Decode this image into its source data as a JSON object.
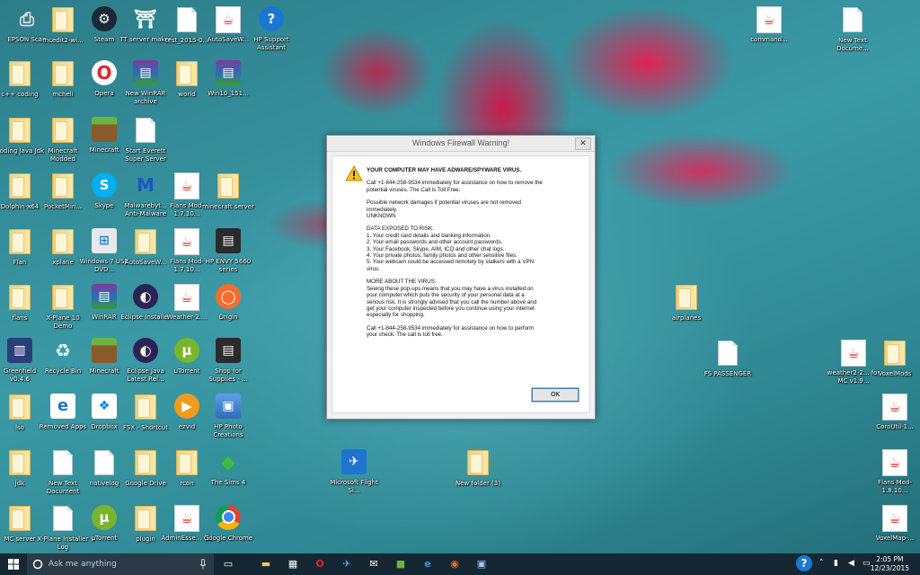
{
  "desktop_icons": [
    {
      "label": "EPSON Scan",
      "icon": "scanner-icon"
    },
    {
      "label": "mcedit2-wi...",
      "icon": "folder-icon"
    },
    {
      "label": "Steam",
      "icon": "steam-icon"
    },
    {
      "label": "TT server maker",
      "icon": "tt-icon"
    },
    {
      "label": "test_2015-0...",
      "icon": "document-icon"
    },
    {
      "label": "AutoSaveW...",
      "icon": "java-icon"
    },
    {
      "label": "HP Support Assistant",
      "icon": "help-icon"
    },
    {
      "label": "c++ coding",
      "icon": "folder-icon"
    },
    {
      "label": "mcheli",
      "icon": "folder-icon"
    },
    {
      "label": "Opera",
      "icon": "opera-icon"
    },
    {
      "label": "New WinRAR archive",
      "icon": "winrar-icon"
    },
    {
      "label": "world",
      "icon": "folder-icon"
    },
    {
      "label": "Win10_151...",
      "icon": "winrar-icon"
    },
    {
      "label": "Coding Java Jdk",
      "icon": "folder-icon"
    },
    {
      "label": "Minecraft Modded",
      "icon": "folder-icon"
    },
    {
      "label": "Minecraft",
      "icon": "minecraft-icon"
    },
    {
      "label": "Start Everett Super Server",
      "icon": "document-icon"
    },
    {
      "label": "Dolphin-x64",
      "icon": "folder-icon"
    },
    {
      "label": "PocketMin...",
      "icon": "folder-icon"
    },
    {
      "label": "Skype",
      "icon": "skype-icon"
    },
    {
      "label": "Malwarebyt... Anti-Malware",
      "icon": "malwarebytes-icon"
    },
    {
      "label": "Flans Mod-1.7.10...",
      "icon": "java-icon"
    },
    {
      "label": "minecraft server",
      "icon": "folder-icon"
    },
    {
      "label": "Flan",
      "icon": "folder-icon"
    },
    {
      "label": "xplane",
      "icon": "folder-icon"
    },
    {
      "label": "Windows 7 USB DVD...",
      "icon": "windows-usb-icon"
    },
    {
      "label": "AutoSaveW...",
      "icon": "folder-icon"
    },
    {
      "label": "Flans Mod-1.7.10...",
      "icon": "java-icon"
    },
    {
      "label": "HP ENVY 5660 series",
      "icon": "printer-icon"
    },
    {
      "label": "flans",
      "icon": "folder-icon"
    },
    {
      "label": "X-Plane 10 Demo",
      "icon": "folder-icon"
    },
    {
      "label": "WinRAR",
      "icon": "winrar-icon"
    },
    {
      "label": "Eclipse Installer",
      "icon": "eclipse-icon"
    },
    {
      "label": "Weather-2....",
      "icon": "java-icon"
    },
    {
      "label": "Origin",
      "icon": "origin-icon"
    },
    {
      "label": "Greenfield v0.4.6",
      "icon": "greenfield-icon"
    },
    {
      "label": "Recycle Bin",
      "icon": "recycle-bin-icon"
    },
    {
      "label": "Minecraft",
      "icon": "minecraft-icon"
    },
    {
      "label": "Eclipse Java Latest Rel...",
      "icon": "eclipse-icon"
    },
    {
      "label": "uTorrent",
      "icon": "utorrent-icon"
    },
    {
      "label": "Shop for Supplies - ...",
      "icon": "printer-icon"
    },
    {
      "label": "lso",
      "icon": "folder-icon"
    },
    {
      "label": "Removed Apps",
      "icon": "edge-icon"
    },
    {
      "label": "Dropbox",
      "icon": "dropbox-icon"
    },
    {
      "label": "FSX - Shortcut",
      "icon": "folder-icon"
    },
    {
      "label": "ezvid",
      "icon": "ezvid-icon"
    },
    {
      "label": "HP Photo Creations",
      "icon": "photo-icon"
    },
    {
      "label": "jdk",
      "icon": "folder-icon"
    },
    {
      "label": "New Text Document",
      "icon": "document-icon"
    },
    {
      "label": "nativelog",
      "icon": "document-icon"
    },
    {
      "label": "Google Drive",
      "icon": "folder-icon"
    },
    {
      "label": "rcon",
      "icon": "folder-icon"
    },
    {
      "label": "The Sims 4",
      "icon": "sims-icon"
    },
    {
      "label": "MC server",
      "icon": "folder-icon"
    },
    {
      "label": "X-Plane Installer Log",
      "icon": "document-icon"
    },
    {
      "label": "µTorrent",
      "icon": "utorrent-icon"
    },
    {
      "label": "plugin",
      "icon": "folder-icon"
    },
    {
      "label": "AdminEsse... (1)",
      "icon": "java-icon"
    },
    {
      "label": "Google Chrome",
      "icon": "chrome-icon"
    },
    {
      "label": "command...",
      "icon": "java-icon"
    },
    {
      "label": "New Text Docume...",
      "icon": "document-icon"
    },
    {
      "label": "airplanes",
      "icon": "folder-icon"
    },
    {
      "label": "FS PASSENGER",
      "icon": "document-icon"
    },
    {
      "label": "weather2-2... for MC v1.9...",
      "icon": "java-icon"
    },
    {
      "label": "VoxelMods",
      "icon": "folder-icon"
    },
    {
      "label": "CoroUtil-1...",
      "icon": "java-icon"
    },
    {
      "label": "Microsoft Flight Si...",
      "icon": "flight-sim-icon"
    },
    {
      "label": "New folder (3)",
      "icon": "folder-icon"
    },
    {
      "label": "Flans Mod-1.8.10...",
      "icon": "java-icon"
    },
    {
      "label": "VoxelMap-...",
      "icon": "java-icon"
    }
  ],
  "dialog": {
    "title": "Windows Firewall Warning!",
    "heading": "YOUR COMPUTER MAY HAVE ADWARE/SPYWARE VIRUS.",
    "call_line_1": "Call +1-844-258-9534  immediately for assistance on how to remove the",
    "call_line_2": "potential viruses. The Call is Toll Free.",
    "damage_line_1": "Possible network damages if potential viruses are not removed",
    "damage_line_2": "immediately.",
    "damage_line_3": "UNKNOWN",
    "exposed_heading": "DATA EXPOSED TO RISK:",
    "exposed_1": "1. Your credit card details and banking information.",
    "exposed_2": "2. Your email passwords and other account passwords.",
    "exposed_3": "3. Your Facebook, Skype, AIM, ICQ and other chat logs.",
    "exposed_4": "4. Your private photos, family photos and other sensitive files.",
    "exposed_5a": "5. Your webcam could be accessed remotely by stalkers with a VPN",
    "exposed_5b": "virus.",
    "more_heading": "MORE ABOUT THE VIRUS:",
    "more_1": "Seeing these pop-ups means that you may have a virus installed on",
    "more_2": "your computer which puts the security of your personal data at a",
    "more_3": "serious risk. It is strongly advised that you call the number above and",
    "more_4": "get your computer inspected before you continue using your internet",
    "more_5": "especially for shopping.",
    "final_1": "Call +1-844-258-9534  immediately for assistance on how to perform",
    "final_2": "your check. The call is toll free.",
    "ok_label": "OK",
    "close_label": "✕"
  },
  "taskbar": {
    "search_placeholder": "Ask me anything",
    "time": "2:05 PM",
    "date": "12/23/2015"
  }
}
